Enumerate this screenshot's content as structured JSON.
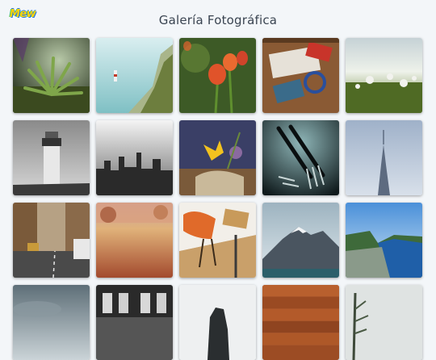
{
  "header": {
    "logo_text": "Mew",
    "title": "Galería Fotográfica"
  },
  "gallery": {
    "photos": [
      {
        "icon": "plant-photo"
      },
      {
        "icon": "lighthouse-cliff-photo"
      },
      {
        "icon": "tulips-photo"
      },
      {
        "icon": "desk-flatlay-photo"
      },
      {
        "icon": "dandelion-field-photo"
      },
      {
        "icon": "bw-lighthouse-photo"
      },
      {
        "icon": "bw-city-skyline-photo"
      },
      {
        "icon": "flowers-photo"
      },
      {
        "icon": "forks-photo"
      },
      {
        "icon": "skyscraper-photo"
      },
      {
        "icon": "street-photo"
      },
      {
        "icon": "autumn-path-photo"
      },
      {
        "icon": "desk-chair-photo"
      },
      {
        "icon": "mountain-lake-photo"
      },
      {
        "icon": "fjord-photo"
      },
      {
        "icon": "cloudy-sky-photo"
      },
      {
        "icon": "bw-interior-photo"
      },
      {
        "icon": "rock-photo"
      },
      {
        "icon": "wood-texture-photo"
      },
      {
        "icon": "tree-photo"
      }
    ]
  }
}
